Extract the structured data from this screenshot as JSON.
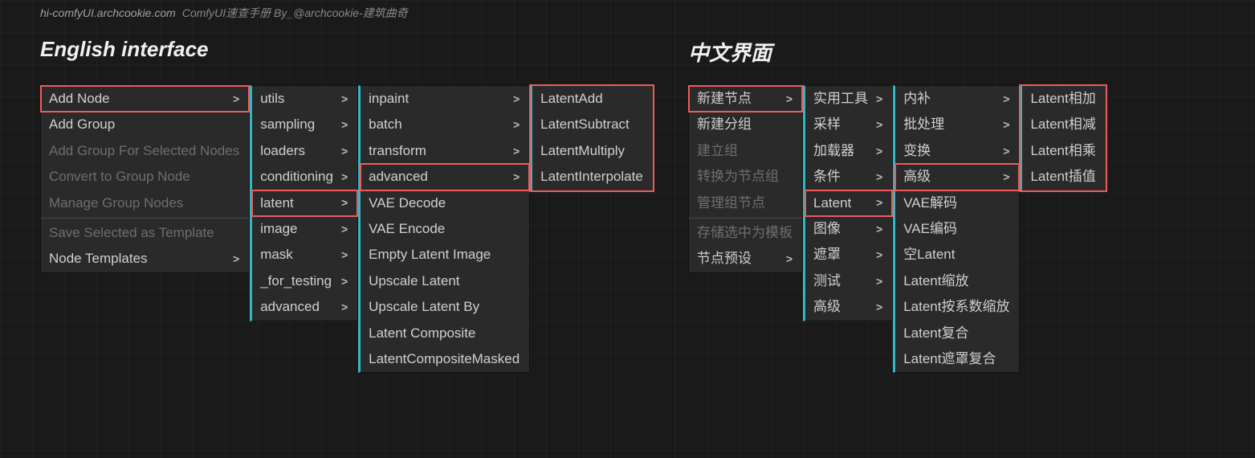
{
  "header": {
    "url": "hi-comfyUI.archcookie.com",
    "subtitle": "ComfyUI速查手册 By_@archcookie-建筑曲奇"
  },
  "titles": {
    "en": "English interface",
    "cn": "中文界面"
  },
  "en": {
    "menu1": [
      {
        "label": "Add Node",
        "arrow": true,
        "hl": true
      },
      {
        "label": "Add Group"
      },
      {
        "label": "Add Group For Selected Nodes",
        "disabled": true
      },
      {
        "label": "Convert to Group Node",
        "disabled": true
      },
      {
        "label": "Manage Group Nodes",
        "disabled": true
      },
      {
        "label": "Save Selected as Template",
        "disabled": true,
        "sep": true
      },
      {
        "label": "Node Templates",
        "arrow": true
      }
    ],
    "menu2": [
      {
        "label": "utils",
        "arrow": true
      },
      {
        "label": "sampling",
        "arrow": true
      },
      {
        "label": "loaders",
        "arrow": true
      },
      {
        "label": "conditioning",
        "arrow": true
      },
      {
        "label": "latent",
        "arrow": true,
        "hl": true
      },
      {
        "label": "image",
        "arrow": true
      },
      {
        "label": "mask",
        "arrow": true
      },
      {
        "label": "_for_testing",
        "arrow": true
      },
      {
        "label": "advanced",
        "arrow": true
      }
    ],
    "menu3": [
      {
        "label": "inpaint",
        "arrow": true
      },
      {
        "label": "batch",
        "arrow": true
      },
      {
        "label": "transform",
        "arrow": true
      },
      {
        "label": "advanced",
        "arrow": true,
        "hl": true
      },
      {
        "label": "VAE Decode"
      },
      {
        "label": "VAE Encode"
      },
      {
        "label": "Empty Latent Image"
      },
      {
        "label": "Upscale Latent"
      },
      {
        "label": "Upscale Latent By"
      },
      {
        "label": "Latent Composite"
      },
      {
        "label": "LatentCompositeMasked"
      }
    ],
    "menu4": [
      {
        "label": "LatentAdd",
        "hl": true
      },
      {
        "label": "LatentSubtract",
        "hl": true
      },
      {
        "label": "LatentMultiply",
        "hl": true
      },
      {
        "label": "LatentInterpolate",
        "hl": true
      }
    ]
  },
  "cn": {
    "menu1": [
      {
        "label": "新建节点",
        "arrow": true,
        "hl": true
      },
      {
        "label": "新建分组"
      },
      {
        "label": "建立组",
        "disabled": true
      },
      {
        "label": "转换为节点组",
        "disabled": true
      },
      {
        "label": "管理组节点",
        "disabled": true
      },
      {
        "label": "存储选中为模板",
        "disabled": true,
        "sep": true
      },
      {
        "label": "节点预设",
        "arrow": true
      }
    ],
    "menu2": [
      {
        "label": "实用工具",
        "arrow": true
      },
      {
        "label": "采样",
        "arrow": true
      },
      {
        "label": "加载器",
        "arrow": true
      },
      {
        "label": "条件",
        "arrow": true
      },
      {
        "label": "Latent",
        "arrow": true,
        "hl": true
      },
      {
        "label": "图像",
        "arrow": true
      },
      {
        "label": "遮罩",
        "arrow": true
      },
      {
        "label": "测试",
        "arrow": true
      },
      {
        "label": "高级",
        "arrow": true
      }
    ],
    "menu3": [
      {
        "label": "内补",
        "arrow": true
      },
      {
        "label": "批处理",
        "arrow": true
      },
      {
        "label": "变换",
        "arrow": true
      },
      {
        "label": "高级",
        "arrow": true,
        "hl": true
      },
      {
        "label": "VAE解码"
      },
      {
        "label": "VAE编码"
      },
      {
        "label": "空Latent"
      },
      {
        "label": "Latent缩放"
      },
      {
        "label": "Latent按系数缩放"
      },
      {
        "label": "Latent复合"
      },
      {
        "label": "Latent遮罩复合"
      }
    ],
    "menu4": [
      {
        "label": "Latent相加",
        "hl": true
      },
      {
        "label": "Latent相减",
        "hl": true
      },
      {
        "label": "Latent相乘",
        "hl": true
      },
      {
        "label": "Latent插值",
        "hl": true
      }
    ]
  }
}
